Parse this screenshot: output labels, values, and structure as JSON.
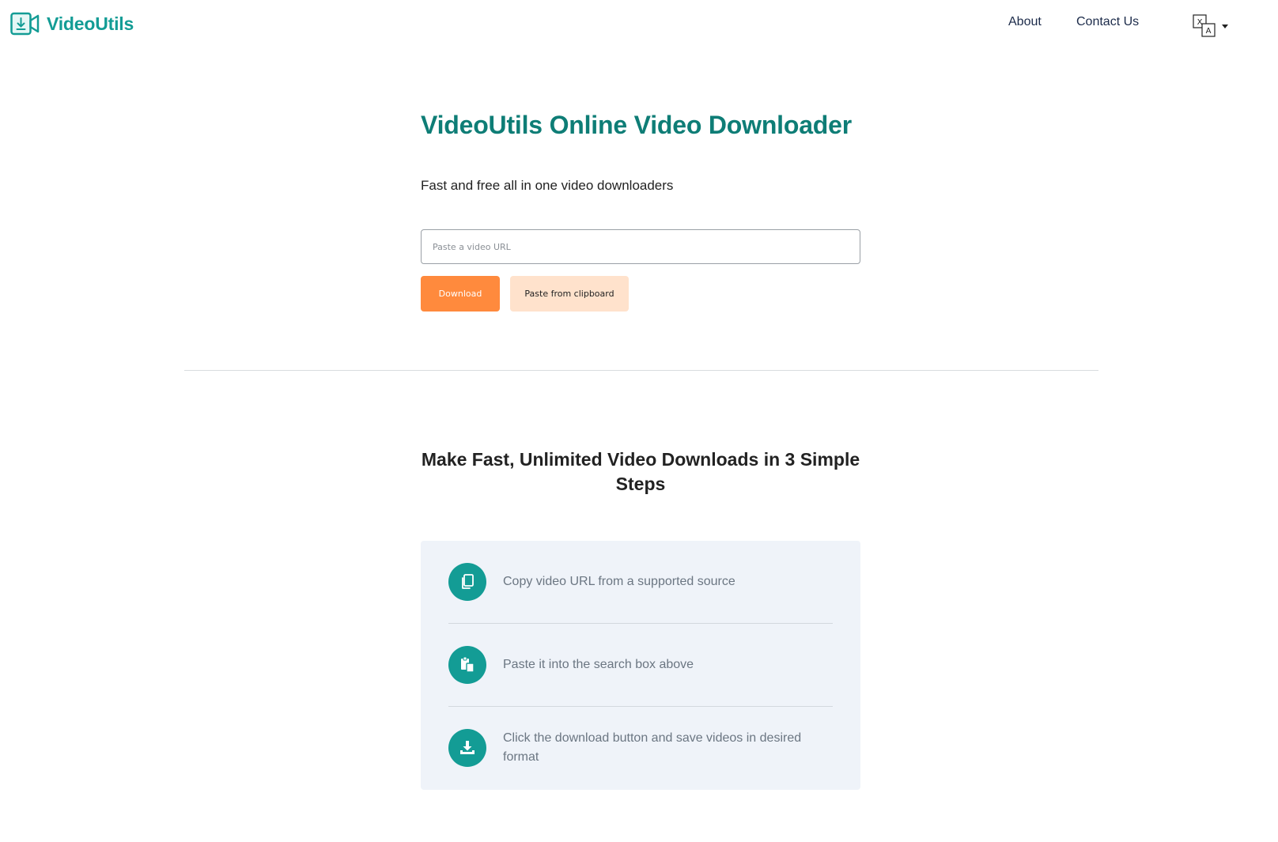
{
  "header": {
    "brand": "VideoUtils",
    "brand_color": "#139c95",
    "nav": [
      {
        "label": "About"
      },
      {
        "label": "Contact Us"
      }
    ],
    "language_icon": "translate-icon"
  },
  "hero": {
    "title": "VideoUtils Online Video Downloader",
    "title_color": "#0e7d76",
    "subtitle": "Fast and free all in one video downloaders",
    "input_placeholder": "Paste a video URL",
    "input_value": "",
    "download_label": "Download",
    "download_color": "#ff8a3d",
    "paste_label": "Paste from clipboard",
    "paste_color": "#ffe2cc"
  },
  "steps": {
    "title": "Make Fast, Unlimited Video Downloads in 3 Simple Steps",
    "items": [
      {
        "icon": "copy-icon",
        "text": "Copy video URL from a supported source"
      },
      {
        "icon": "paste-icon",
        "text": "Paste it into the search box above"
      },
      {
        "icon": "download-icon",
        "text": "Click the download button and save videos in desired format"
      }
    ]
  }
}
